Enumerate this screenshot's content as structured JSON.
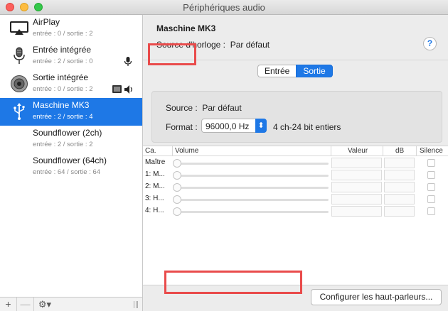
{
  "window": {
    "title": "Périphériques audio"
  },
  "sidebar": {
    "devices": [
      {
        "name": "AirPlay",
        "sub": "entrée : 0 / sortie : 2",
        "icon": "airplay-icon"
      },
      {
        "name": "Entrée intégrée",
        "sub": "entrée : 2 / sortie : 0",
        "icon": "microphone-icon",
        "badge": "microphone-badge-icon"
      },
      {
        "name": "Sortie intégrée",
        "sub": "entrée : 0 / sortie : 2",
        "icon": "speaker-icon",
        "badge": "speaker-badge-icon"
      },
      {
        "name": "Maschine MK3",
        "sub": "entrée : 2 / sortie : 4",
        "icon": "usb-icon",
        "selected": true
      },
      {
        "name": "Soundflower (2ch)",
        "sub": "entrée : 2 / sortie : 2",
        "icon": ""
      },
      {
        "name": "Soundflower (64ch)",
        "sub": "entrée : 64 / sortie : 64",
        "icon": ""
      }
    ],
    "footer": {
      "add": "+",
      "remove": "—",
      "gear": "⚙▾"
    }
  },
  "main": {
    "device_title": "Maschine MK3",
    "clock_label": "Source d'horloge :",
    "clock_value": "Par défaut",
    "help": "?",
    "tabs": {
      "input": "Entrée",
      "output": "Sortie",
      "selected": "output"
    },
    "source_label": "Source :",
    "source_value": "Par défaut",
    "format_label": "Format :",
    "format_value": "96000,0 Hz",
    "format_desc": "4 ch-24 bit entiers",
    "table": {
      "headers": {
        "channel": "Ca.",
        "volume": "Volume",
        "value": "Valeur",
        "db": "dB",
        "mute": "Silence"
      },
      "rows": [
        {
          "channel": "Maître"
        },
        {
          "channel": "1: M..."
        },
        {
          "channel": "2: M..."
        },
        {
          "channel": "3: H..."
        },
        {
          "channel": "4: H..."
        }
      ]
    },
    "configure_button": "Configurer les haut-parleurs..."
  },
  "colors": {
    "accent": "#1e78e6",
    "highlight": "#e94b4b"
  }
}
